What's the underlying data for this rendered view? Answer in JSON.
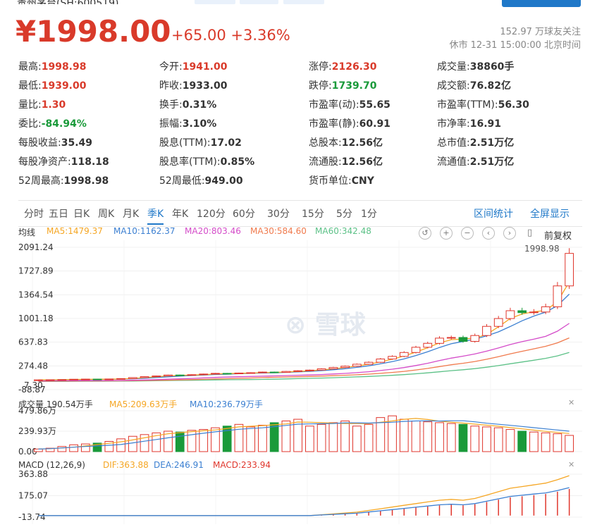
{
  "header": {
    "price": "¥1998.00",
    "change": "+65.00 +3.36%",
    "followers": "152.97 万球友关注",
    "status": "休市 12-31 15:00:00 北京时间"
  },
  "stats": [
    [
      {
        "label": "最高:",
        "value": "1998.98",
        "color": "red"
      },
      {
        "label": "今开:",
        "value": "1941.00",
        "color": "red"
      },
      {
        "label": "涨停:",
        "value": "2126.30",
        "color": "red"
      },
      {
        "label": "成交量:",
        "value": "38860手",
        "color": ""
      }
    ],
    [
      {
        "label": "最低:",
        "value": "1939.00",
        "color": "red"
      },
      {
        "label": "昨收:",
        "value": "1933.00",
        "color": ""
      },
      {
        "label": "跌停:",
        "value": "1739.70",
        "color": "green"
      },
      {
        "label": "成交额:",
        "value": "76.82亿",
        "color": ""
      }
    ],
    [
      {
        "label": "量比:",
        "value": "1.30",
        "color": "red"
      },
      {
        "label": "换手:",
        "value": "0.31%",
        "color": ""
      },
      {
        "label": "市盈率(动):",
        "value": "55.65",
        "color": ""
      },
      {
        "label": "市盈率(TTM):",
        "value": "56.30",
        "color": ""
      }
    ],
    [
      {
        "label": "委比:",
        "value": "-84.94%",
        "color": "green"
      },
      {
        "label": "振幅:",
        "value": "3.10%",
        "color": ""
      },
      {
        "label": "市盈率(静):",
        "value": "60.91",
        "color": ""
      },
      {
        "label": "市净率:",
        "value": "16.91",
        "color": ""
      }
    ],
    [
      {
        "label": "每股收益:",
        "value": "35.49",
        "color": ""
      },
      {
        "label": "股息(TTM):",
        "value": "17.02",
        "color": ""
      },
      {
        "label": "总股本:",
        "value": "12.56亿",
        "color": ""
      },
      {
        "label": "总市值:",
        "value": "2.51万亿",
        "color": ""
      }
    ],
    [
      {
        "label": "每股净资产:",
        "value": "118.18",
        "color": ""
      },
      {
        "label": "股息率(TTM):",
        "value": "0.85%",
        "color": ""
      },
      {
        "label": "流通股:",
        "value": "12.56亿",
        "color": ""
      },
      {
        "label": "流通值:",
        "value": "2.51万亿",
        "color": ""
      }
    ],
    [
      {
        "label": "52周最高:",
        "value": "1998.98",
        "color": ""
      },
      {
        "label": "52周最低:",
        "value": "949.00",
        "color": ""
      },
      {
        "label": "货币单位:",
        "value": "CNY",
        "color": ""
      }
    ]
  ],
  "tabs": [
    "分时",
    "五日",
    "日K",
    "周K",
    "月K",
    "季K",
    "年K",
    "120分",
    "60分",
    "30分",
    "15分",
    "5分",
    "1分"
  ],
  "active_tab": "季K",
  "tab_links": [
    "区间统计",
    "全屏显示"
  ],
  "legend": {
    "ma_label": "均线",
    "ma5": "MA5:1479.37",
    "ma10": "MA10:1162.37",
    "ma20": "MA20:803.46",
    "ma30": "MA30:584.60",
    "ma60": "MA60:342.48",
    "adjust": "前复权"
  },
  "colors": {
    "up": "#e0362c",
    "down": "#1a9a3a",
    "ma5": "#f5a623",
    "ma10": "#3b7fd1",
    "ma20": "#d44cc9",
    "ma30": "#f07a4d",
    "ma60": "#5cc187",
    "accent": "#1f78c8"
  },
  "vol_legend": {
    "label": "成交量 190.54万手",
    "ma5": "MA5:209.63万手",
    "ma10": "MA10:236.79万手"
  },
  "macd_legend": {
    "label": "MACD (12,26,9)",
    "dif": "DIF:363.88",
    "dea": "DEA:246.91",
    "macd": "MACD:233.94"
  },
  "price_axis": [
    "2091.24",
    "1727.89",
    "1364.54",
    "1001.18",
    "637.83",
    "274.48",
    "-88.87"
  ],
  "price_axis_overlap": "7.30",
  "last_high_label": "1998.98",
  "vol_axis": [
    "479.86万",
    "239.93万",
    "0.00"
  ],
  "macd_axis": [
    "363.88",
    "175.07",
    "-13.74"
  ],
  "watermark": "雪球",
  "chart_data": {
    "type": "candlestick",
    "ylim": [
      -88.87,
      2091.24
    ],
    "close": [
      60,
      62,
      65,
      70,
      72,
      68,
      74,
      80,
      95,
      110,
      120,
      135,
      130,
      140,
      150,
      160,
      158,
      165,
      170,
      180,
      175,
      190,
      200,
      210,
      230,
      250,
      270,
      300,
      330,
      380,
      420,
      480,
      560,
      620,
      700,
      710,
      650,
      740,
      880,
      1000,
      1120,
      1090,
      1100,
      1180,
      1500,
      1998
    ],
    "volume_wan": [
      30,
      40,
      60,
      80,
      90,
      100,
      120,
      150,
      180,
      200,
      220,
      240,
      230,
      250,
      260,
      280,
      300,
      320,
      290,
      310,
      340,
      360,
      380,
      300,
      320,
      340,
      360,
      300,
      320,
      400,
      420,
      380,
      360,
      350,
      340,
      330,
      320,
      300,
      290,
      280,
      260,
      240,
      230,
      220,
      210,
      190.54
    ],
    "macd": [
      0,
      0,
      0,
      0,
      0,
      0,
      0,
      0,
      0,
      0,
      0,
      0,
      0,
      0,
      0,
      0,
      0,
      0,
      0,
      0,
      0,
      0,
      0,
      0,
      5,
      10,
      15,
      20,
      30,
      40,
      50,
      60,
      70,
      80,
      90,
      95,
      90,
      100,
      120,
      140,
      160,
      170,
      180,
      190,
      210,
      233.94
    ]
  }
}
